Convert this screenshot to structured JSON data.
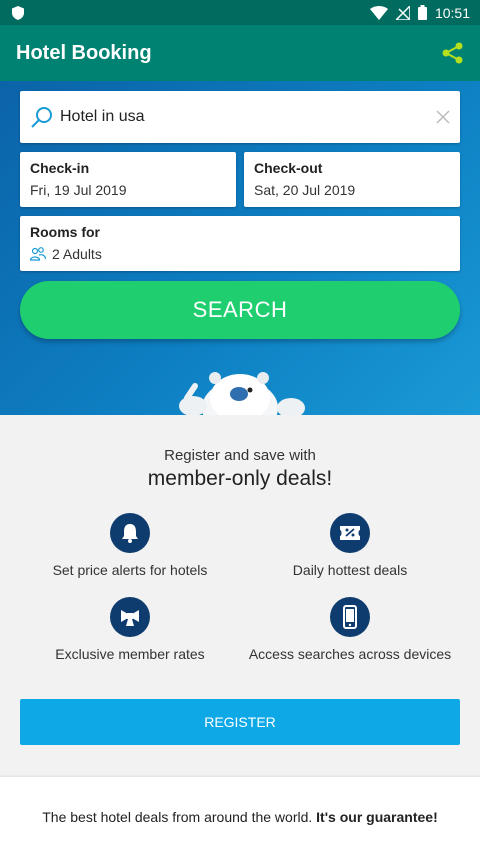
{
  "status_bar": {
    "time": "10:51"
  },
  "app_bar": {
    "title": "Hotel Booking"
  },
  "search": {
    "destination": "Hotel in usa",
    "checkin": {
      "label": "Check-in",
      "value": "Fri, 19 Jul 2019"
    },
    "checkout": {
      "label": "Check-out",
      "value": "Sat, 20 Jul 2019"
    },
    "rooms": {
      "label": "Rooms for",
      "value": "2 Adults"
    },
    "button_label": "SEARCH"
  },
  "promo": {
    "line1": "Register and save with",
    "line2": "member-only deals!",
    "features": [
      {
        "label": "Set price alerts for hotels",
        "icon": "bell-icon"
      },
      {
        "label": "Daily hottest deals",
        "icon": "ticket-icon"
      },
      {
        "label": "Exclusive member rates",
        "icon": "bowtie-icon"
      },
      {
        "label": "Access searches across devices",
        "icon": "phone-icon"
      }
    ],
    "register_label": "REGISTER"
  },
  "guarantee": {
    "text": "The best hotel deals from around the world.",
    "bold": "It's our guarantee!"
  },
  "colors": {
    "status_bar": "#006b5e",
    "app_bar": "#008272",
    "search_button": "#1fcf6f",
    "register_button": "#0fa8e6",
    "feature_icon_bg": "#0e3c6e",
    "share_icon": "#b5e01f"
  }
}
